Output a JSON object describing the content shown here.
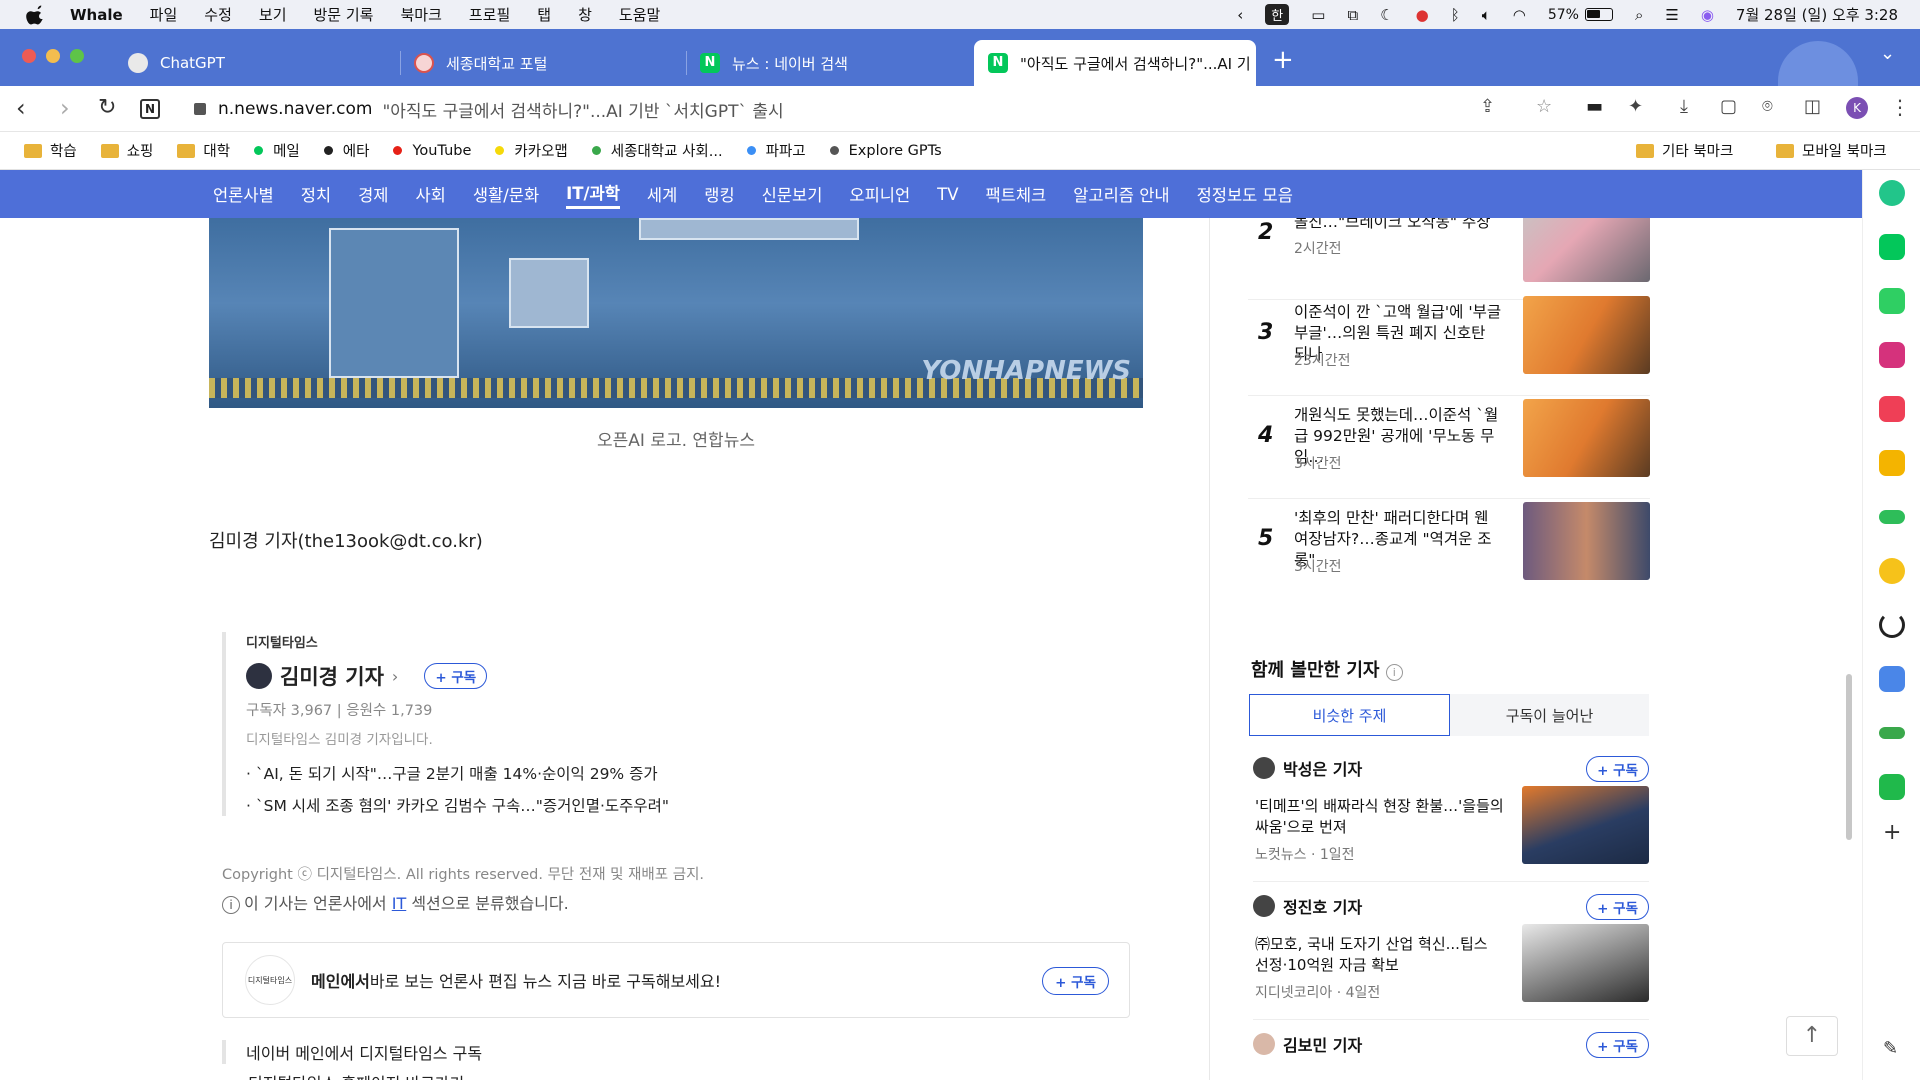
{
  "menubar": {
    "app": "Whale",
    "items": [
      "파일",
      "수정",
      "보기",
      "방문 기록",
      "북마크",
      "프로필",
      "탭",
      "창",
      "도움말"
    ],
    "ime": "한",
    "battery": "57%",
    "datetime": "7월 28일 (일) 오후 3:28"
  },
  "tabs": [
    {
      "label": "ChatGPT",
      "color": "#f0f0f0"
    },
    {
      "label": "세종대학교 포털",
      "color": "#d9534f"
    },
    {
      "label": "뉴스 : 네이버 검색",
      "color": "#03c75a"
    },
    {
      "label": "\"아직도 구글에서 검색하니?\"...AI 기",
      "color": "#03c75a"
    }
  ],
  "address": {
    "domain": "n.news.naver.com",
    "title": "\"아직도 구글에서 검색하니?\"...AI 기반 `서치GPT` 출시",
    "profile": "K"
  },
  "bookmarks": [
    {
      "label": "학습",
      "kind": "folder"
    },
    {
      "label": "쇼핑",
      "kind": "folder"
    },
    {
      "label": "대학",
      "kind": "folder"
    },
    {
      "label": "메일",
      "kind": "dot",
      "color": "#03c75a"
    },
    {
      "label": "에타",
      "kind": "dot",
      "color": "#222"
    },
    {
      "label": "YouTube",
      "kind": "dot",
      "color": "#e62117"
    },
    {
      "label": "카카오맵",
      "kind": "dot",
      "color": "#f5d90a"
    },
    {
      "label": "세종대학교 사회...",
      "kind": "dot",
      "color": "#3aa84b"
    },
    {
      "label": "파파고",
      "kind": "dot",
      "color": "#3b8ff5"
    },
    {
      "label": "Explore GPTs",
      "kind": "dot",
      "color": "#555"
    }
  ],
  "bookmarks_right": [
    "기타 북마크",
    "모바일 북마크"
  ],
  "nav": [
    "언론사별",
    "정치",
    "경제",
    "사회",
    "생활/문화",
    "IT/과학",
    "세계",
    "랭킹",
    "신문보기",
    "오피니언",
    "TV",
    "팩트체크",
    "알고리즘 안내",
    "정정보도 모음"
  ],
  "nav_current": "IT/과학",
  "article": {
    "watermark": "YONHAPNEWS",
    "caption": "오픈AI 로고. 연합뉴스",
    "reporter_line": "김미경 기자(the13ook@dt.co.kr)",
    "card": {
      "press": "디지털타임스",
      "name": "김미경 기자",
      "subscribe": "+ 구독",
      "stats": "구독자 3,967  |  응원수 1,739",
      "intro": "디지털타임스 김미경 기자입니다.",
      "links": [
        "`AI, 돈 되기 시작\"…구글 2분기 매출 14%·순이익 29% 증가",
        "`SM 시세 조종 혐의' 카카오 김범수 구속…\"증거인멸·도주우려\""
      ]
    },
    "copyright": "Copyright ⓒ 디지털타임스. All rights reserved. 무단 전재 및 재배포 금지.",
    "section_note_pre": "이 기사는 언론사에서 ",
    "section_note_it": "IT",
    "section_note_post": " 섹션으로 분류했습니다.",
    "banner_logo": "디지털타임스",
    "banner_bold": "메인에서",
    "banner_text": " 바로 보는 언론사 편집 뉴스 지금 바로 구독해보세요!",
    "banner_btn": "+ 구독",
    "bottom_link1": "네이버 메인에서 디지털타임스 구독",
    "bottom_link2": "디지털타임스 홈페이지 바로가기"
  },
  "ranking": [
    {
      "num": "2",
      "title": "돌진…\"브레이크 오작동\" 주장",
      "ago": "2시간전"
    },
    {
      "num": "3",
      "title": "이준석이 깐 `고액 월급'에 '부글부글'…의원 특권 폐지 신호탄 되나",
      "ago": "23시간전"
    },
    {
      "num": "4",
      "title": "개원식도 못했는데…이준석 `월급 992만원' 공개에 '무노동 무임…",
      "ago": "3시간전"
    },
    {
      "num": "5",
      "title": "'최후의 만찬' 패러디한다며 웬 여장남자?…종교계 \"역겨운 조롱\"",
      "ago": "3시간전"
    }
  ],
  "together": {
    "title": "함께 볼만한 기자",
    "tab_active": "비슷한 주제",
    "tab_other": "구독이 늘어난",
    "journalists": [
      {
        "name": "박성은 기자",
        "title": "'티메프'의 배짜라식 현장 환불…'을들의 싸움'으로 번져",
        "meta": "노컷뉴스 · 1일전",
        "btn": "+ 구독"
      },
      {
        "name": "정진호 기자",
        "title": "㈜모호, 국내 도자기 산업 혁신...팁스 선정·10억원 자금 확보",
        "meta": "지디넷코리아 · 4일전",
        "btn": "+ 구독"
      },
      {
        "name": "김보민 기자",
        "title": "",
        "meta": "",
        "btn": "+ 구독"
      }
    ]
  },
  "totop": "↑"
}
